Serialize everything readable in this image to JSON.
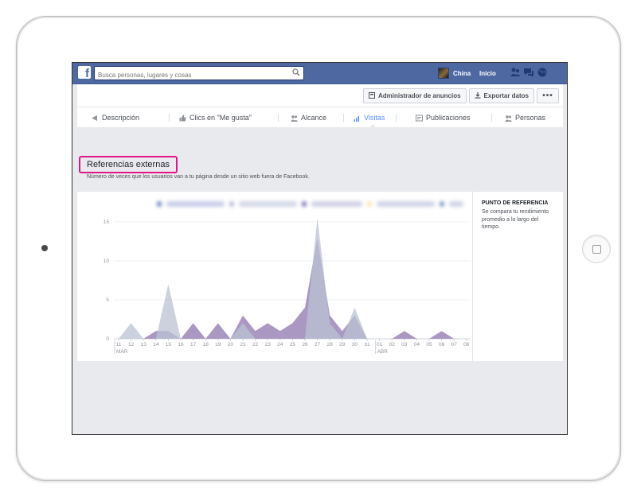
{
  "topbar": {
    "search_placeholder": "Busca personas, lugares y cosas",
    "user_name": "China",
    "home_label": "Inicio"
  },
  "actions": {
    "ads_manager": "Administrador de anuncios",
    "export": "Exportar datos",
    "more": "•••"
  },
  "tabs": [
    {
      "label": "Descripción"
    },
    {
      "label": "Clics en \"Me gusta\""
    },
    {
      "label": "Alcance"
    },
    {
      "label": "Visitas"
    },
    {
      "label": "Publicaciones"
    },
    {
      "label": "Personas"
    }
  ],
  "section": {
    "title": "Referencias externas",
    "subtitle": "Número de veces que los usuarios van a tu página desde un sitio web fuera de Facebook."
  },
  "benchmark": {
    "title": "PUNTO DE REFERENCIA",
    "text": "Se compara tu rendimiento promedio a lo largo del tiempo."
  },
  "colors": {
    "topbar": "#4e69a2",
    "active_tab": "#5890ff",
    "highlight": "#e0168a",
    "series_page": "#9b86b8",
    "series_benchmark": "#b9c3d3"
  },
  "chart_data": {
    "type": "area",
    "ylim": [
      0,
      15
    ],
    "yticks": [
      0,
      5,
      10,
      15
    ],
    "x": [
      "11",
      "12",
      "13",
      "14",
      "15",
      "16",
      "17",
      "18",
      "19",
      "20",
      "21",
      "22",
      "23",
      "24",
      "25",
      "26",
      "27",
      "28",
      "29",
      "30",
      "31",
      "01",
      "02",
      "03",
      "04",
      "05",
      "06",
      "07",
      "08"
    ],
    "month_labels": [
      {
        "label": "MAR",
        "at": "11"
      },
      {
        "label": "ABR",
        "at": "01"
      }
    ],
    "series": [
      {
        "values": [
          0,
          2,
          0,
          0,
          7,
          0,
          0,
          0,
          0,
          0,
          2,
          0,
          0,
          0,
          0,
          0,
          15.5,
          2,
          0,
          4,
          0,
          0,
          0,
          0,
          0,
          0,
          0,
          0,
          0
        ]
      },
      {
        "values": [
          0,
          0,
          0,
          1,
          1,
          0,
          2,
          0,
          2,
          0,
          3,
          1,
          2,
          1,
          2,
          4,
          13,
          3,
          1,
          3,
          0,
          0,
          0,
          1,
          0,
          0,
          1,
          0,
          0
        ]
      }
    ]
  }
}
